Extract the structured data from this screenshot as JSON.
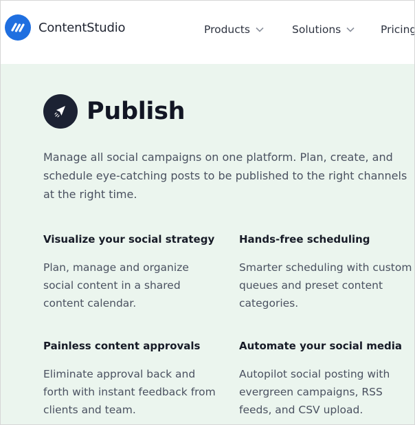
{
  "brand": {
    "name": "ContentStudio",
    "accent": "#1f6fe0"
  },
  "nav": {
    "items": [
      {
        "label": "Products",
        "icon": "chevron-down-icon"
      },
      {
        "label": "Solutions",
        "icon": "chevron-down-icon"
      },
      {
        "label": "Pricing"
      }
    ]
  },
  "publish": {
    "icon": "paper-plane-icon",
    "title": "Publish",
    "intro": "Manage all social campaigns on one platform. Plan, create, and schedule eye-catching posts to be published to the right channels at the right time.",
    "features": [
      {
        "title": "Visualize your social strategy",
        "desc": "Plan, manage and organize social content in a shared content calendar."
      },
      {
        "title": "Hands-free scheduling",
        "desc": "Smarter scheduling with custom queues and preset content categories."
      },
      {
        "title": "Painless content approvals",
        "desc": "Eliminate approval back and forth with instant feedback from clients and team."
      },
      {
        "title": "Automate your social media",
        "desc": "Autopilot social posting with evergreen campaigns, RSS feeds, and CSV upload."
      }
    ]
  },
  "colors": {
    "section_bg": "#ebf5ee",
    "badge_bg": "#1c2233"
  }
}
